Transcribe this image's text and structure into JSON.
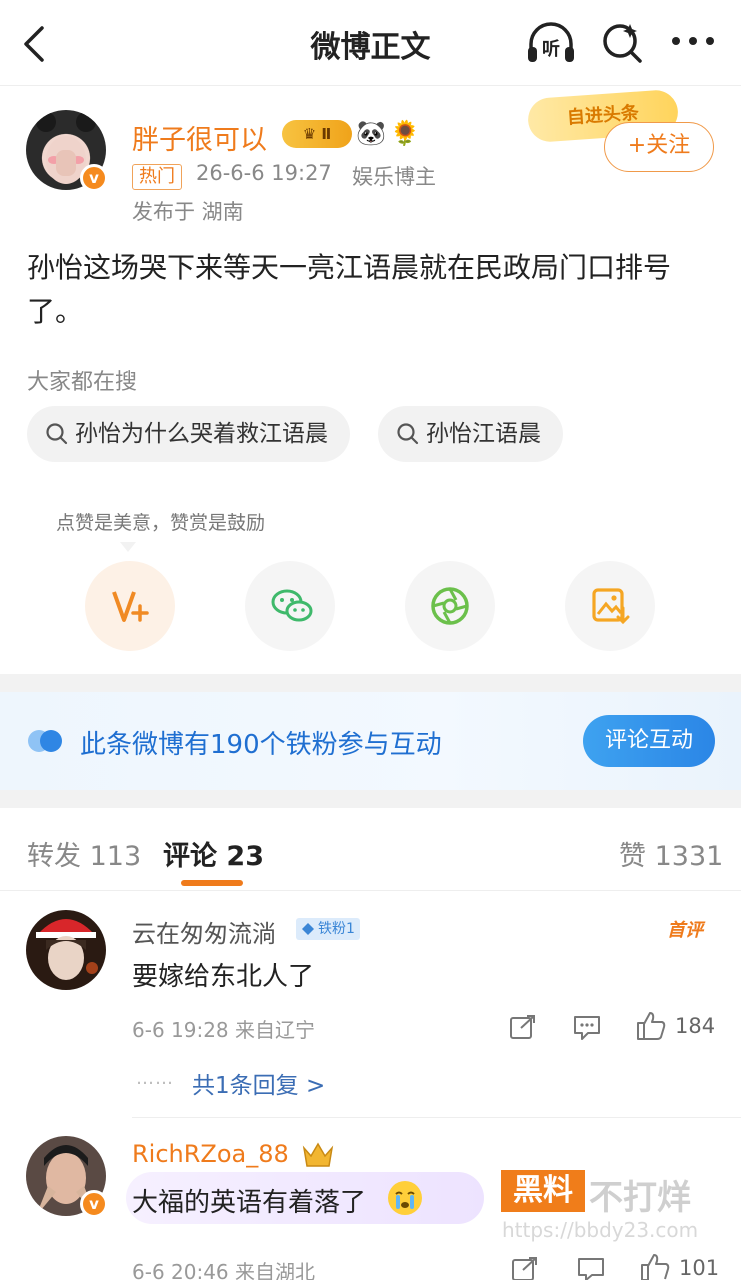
{
  "nav": {
    "title": "微博正文",
    "listen_label": "听"
  },
  "post": {
    "author": "胖子很可以",
    "vip_level": "Ⅱ",
    "deco_emojis": [
      "🐼",
      "🌻"
    ],
    "verified_mark": "v",
    "hot_tag": "热门",
    "time": "26-6-6 19:27",
    "category": "娱乐博主",
    "location": "发布于 湖南",
    "follow_deco_text": "自进头条",
    "follow_label": "+关注",
    "text": "孙怡这场哭下来等天一亮江语晨就在民政局门口排号了。"
  },
  "search": {
    "title": "大家都在搜",
    "items": [
      "孙怡为什么哭着救江语晨",
      "孙怡江语晨"
    ]
  },
  "actions": {
    "tip": "点赞是美意，赞赏是鼓励",
    "items": [
      "v-plus",
      "wechat",
      "moments",
      "save-image"
    ]
  },
  "fans_banner": {
    "text": "此条微博有190个铁粉参与互动",
    "button": "评论互动"
  },
  "tabs": {
    "repost_label": "转发",
    "repost_count": "113",
    "comment_label": "评论",
    "comment_count": "23",
    "like_label": "赞",
    "like_count": "1331"
  },
  "comments": [
    {
      "name": "云在匆匆流淌",
      "fan_badge": "铁粉1",
      "first_badge": "首评",
      "text": "要嫁给东北人了",
      "meta": "6-6 19:28  来自辽宁",
      "likes": "184",
      "reply_text": "共1条回复 >",
      "reply_dots": "……"
    },
    {
      "name": "RichRZoa_88",
      "text": "大福的英语有着落了",
      "meta": "6-6 20:46  来自湖北",
      "likes": "101"
    }
  ],
  "watermark": {
    "box": "黑料",
    "text": "不打烊",
    "url": "https://bbdy23.com"
  },
  "colors": {
    "accent": "#ef7b1c",
    "link": "#1f6fd1",
    "gray_text": "#888888"
  }
}
